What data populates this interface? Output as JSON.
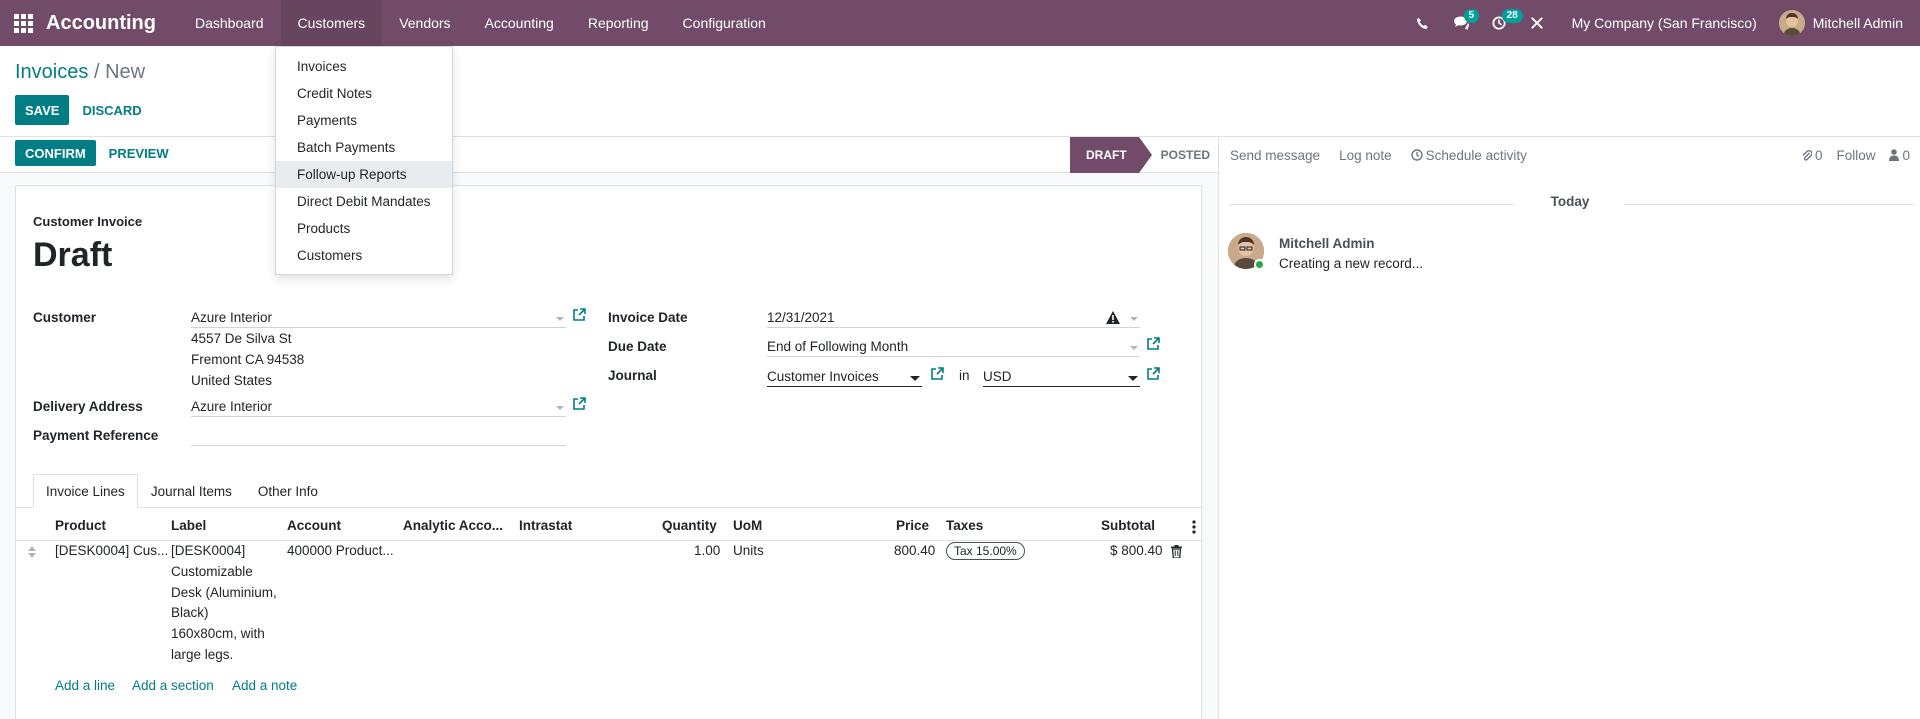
{
  "navbar": {
    "app_name": "Accounting",
    "menu": [
      "Dashboard",
      "Customers",
      "Vendors",
      "Accounting",
      "Reporting",
      "Configuration"
    ],
    "active_menu": "Customers",
    "messages_badge": "5",
    "activities_badge": "28",
    "company": "My Company (San Francisco)",
    "user": "Mitchell Admin",
    "icons": [
      "apps-icon",
      "phone-icon",
      "chat-icon",
      "clock-icon",
      "tools-icon"
    ],
    "bg_color": "#714b67"
  },
  "breadcrumb": {
    "parent": "Invoices",
    "separator": "/",
    "current": "New"
  },
  "actions": {
    "save": "Save",
    "discard": "Discard"
  },
  "statusbar": {
    "confirm": "Confirm",
    "preview": "Preview",
    "steps": [
      "Draft",
      "Posted"
    ],
    "current_step": "Draft"
  },
  "form": {
    "doc_type": "Customer Invoice",
    "title": "Draft",
    "customer_label": "Customer",
    "customer": "Azure Interior",
    "address": [
      "4557 De Silva St",
      "Fremont CA 94538",
      "United States"
    ],
    "delivery_label": "Delivery Address",
    "delivery": "Azure Interior",
    "payment_ref_label": "Payment Reference",
    "payment_ref": "",
    "invoice_date_label": "Invoice Date",
    "invoice_date": "12/31/2021",
    "due_date_label": "Due Date",
    "due_date": "End of Following Month",
    "journal_label": "Journal",
    "journal": "Customer Invoices",
    "in_label": "in",
    "currency": "USD"
  },
  "tabs": [
    "Invoice Lines",
    "Journal Items",
    "Other Info"
  ],
  "table": {
    "columns": [
      "Product",
      "Label",
      "Account",
      "Analytic Acco...",
      "Intrastat",
      "Quantity",
      "UoM",
      "Price",
      "Taxes",
      "Subtotal"
    ],
    "rows": [
      {
        "product": "[DESK0004] Cus...",
        "label": [
          "[DESK0004]",
          "Customizable",
          "Desk (Aluminium,",
          "Black)",
          "160x80cm, with",
          "large legs."
        ],
        "account": "400000 Product...",
        "quantity": "1.00",
        "uom": "Units",
        "price": "800.40",
        "tax": "Tax 15.00%",
        "subtotal": "$ 800.40"
      }
    ],
    "add_line": "Add a line",
    "add_section": "Add a section",
    "add_note": "Add a note"
  },
  "chatter": {
    "send_message": "Send message",
    "log_note": "Log note",
    "schedule_activity": "Schedule activity",
    "attachments": "0",
    "follow": "Follow",
    "followers": "0",
    "date_separator": "Today",
    "message_author": "Mitchell Admin",
    "message_body": "Creating a new record..."
  },
  "dropdown": {
    "items": [
      "Invoices",
      "Credit Notes",
      "Payments",
      "Batch Payments",
      "Follow-up Reports",
      "Direct Debit Mandates",
      "Products",
      "Customers"
    ],
    "hovered": "Follow-up Reports"
  },
  "colors": {
    "primary": "#017e84",
    "brand": "#714b67",
    "online": "#28a745",
    "badge": "#00a09d"
  }
}
